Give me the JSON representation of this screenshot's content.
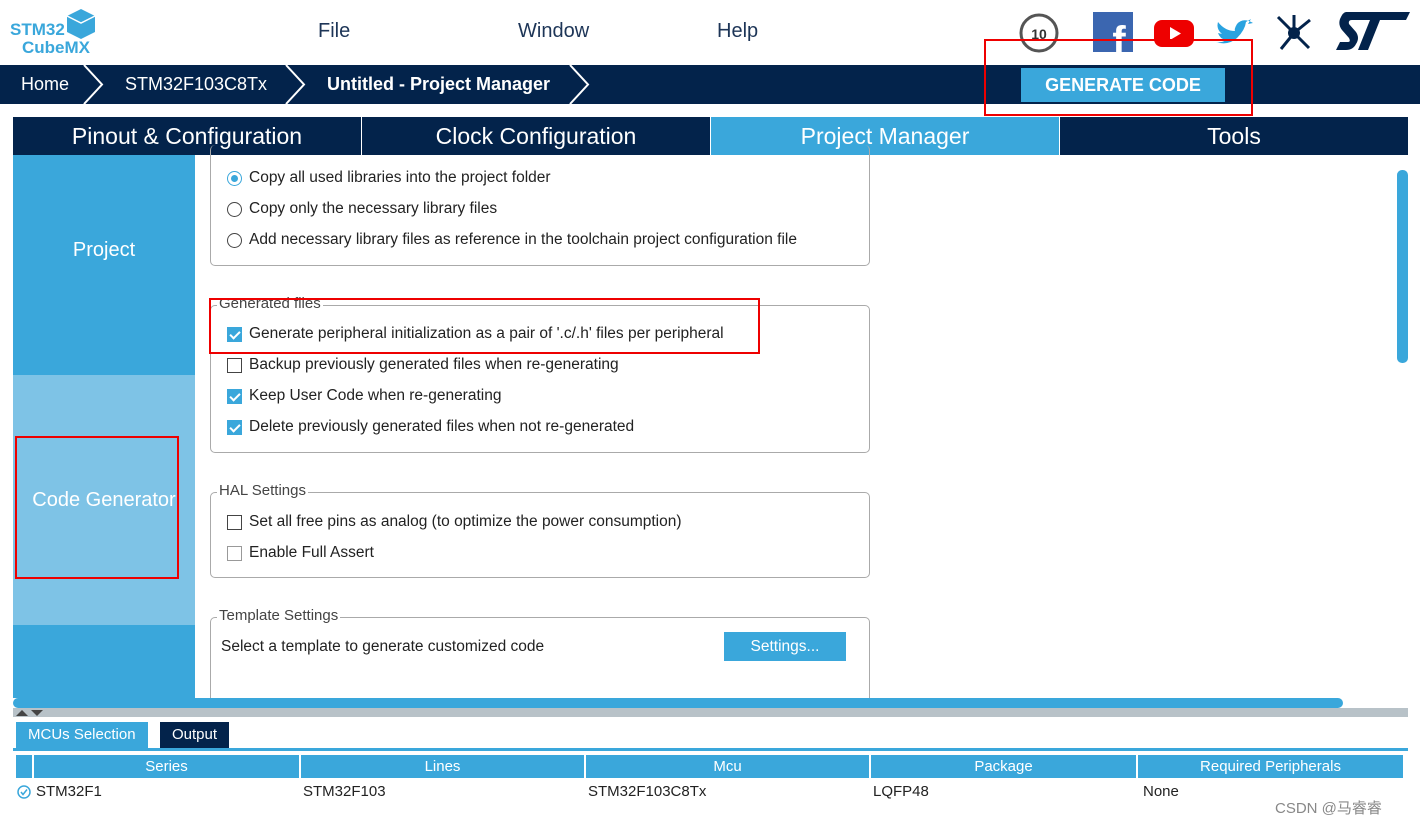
{
  "app": {
    "logo_line1": "STM32",
    "logo_line2": "CubeMX"
  },
  "menu": {
    "file": "File",
    "window": "Window",
    "help": "Help"
  },
  "breadcrumb": {
    "home": "Home",
    "mcu": "STM32F103C8Tx",
    "current": "Untitled - Project Manager"
  },
  "generate_label": "GENERATE CODE",
  "tabs": [
    "Pinout & Configuration",
    "Clock Configuration",
    "Project Manager",
    "Tools"
  ],
  "active_tab": "Project Manager",
  "sidebar": {
    "items": [
      {
        "label": "Project"
      },
      {
        "label": "Code Generator"
      }
    ],
    "selected": "Code Generator"
  },
  "library_options": {
    "items": [
      {
        "label": "Copy all used libraries into the project folder",
        "selected": true
      },
      {
        "label": "Copy only the necessary library files",
        "selected": false
      },
      {
        "label": "Add necessary library files as reference in the toolchain project configuration file",
        "selected": false
      }
    ]
  },
  "generated_files": {
    "title": "Generated files",
    "items": [
      {
        "label": "Generate peripheral initialization as a pair of '.c/.h' files per peripheral",
        "checked": true
      },
      {
        "label": "Backup previously generated files when re-generating",
        "checked": false
      },
      {
        "label": "Keep User Code when re-generating",
        "checked": true
      },
      {
        "label": "Delete previously generated files when not re-generated",
        "checked": true
      }
    ]
  },
  "hal_settings": {
    "title": "HAL Settings",
    "items": [
      {
        "label": "Set all free pins as analog (to optimize the power consumption)",
        "checked": false
      },
      {
        "label": "Enable Full Assert",
        "checked": false
      }
    ]
  },
  "template_settings": {
    "title": "Template Settings",
    "description": "Select a template to generate customized code",
    "button": "Settings..."
  },
  "bottom_tabs": [
    "MCUs Selection",
    "Output"
  ],
  "table": {
    "columns": [
      "Series",
      "Lines",
      "Mcu",
      "Package",
      "Required Peripherals"
    ],
    "rows": [
      [
        "STM32F1",
        "STM32F103",
        "STM32F103C8Tx",
        "LQFP48",
        "None"
      ]
    ]
  },
  "watermark": "CSDN @马睿睿",
  "colors": {
    "navy": "#03234b",
    "accent": "#3aa7db",
    "highlight": "#e00000"
  }
}
